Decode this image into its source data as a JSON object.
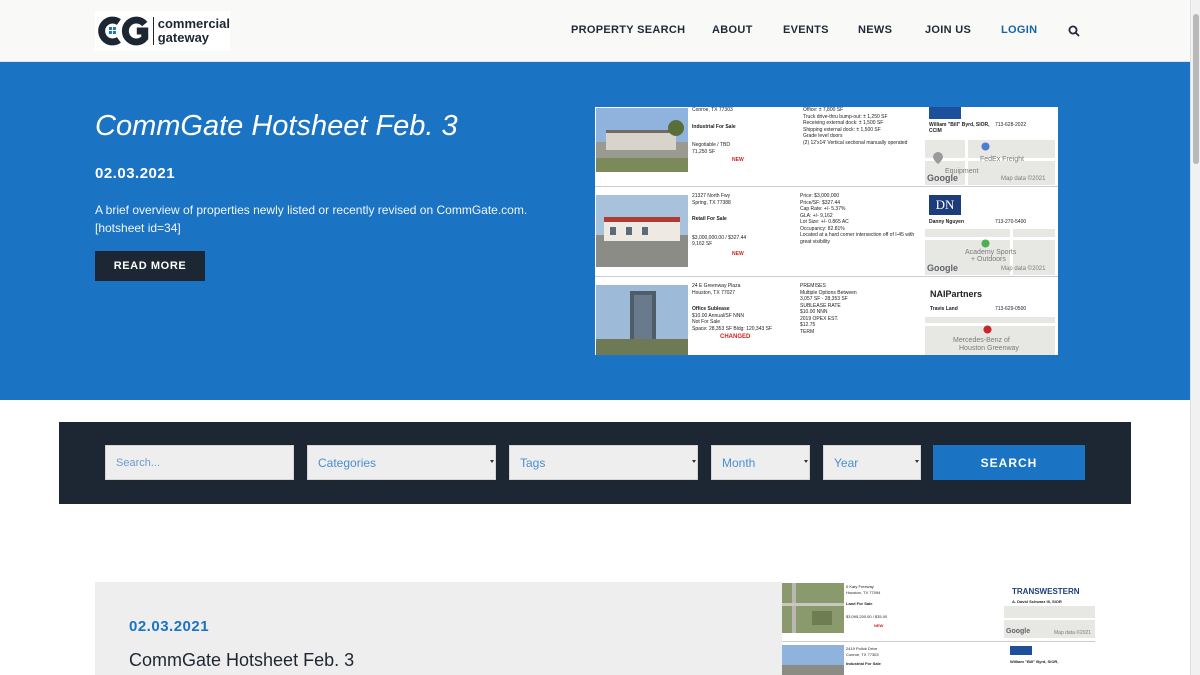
{
  "header": {
    "logo_mark": "CG",
    "logo_line1": "commercial",
    "logo_line2": "gateway",
    "nav": [
      {
        "label": "PROPERTY SEARCH"
      },
      {
        "label": "ABOUT"
      },
      {
        "label": "EVENTS"
      },
      {
        "label": "NEWS"
      },
      {
        "label": "JOIN US"
      },
      {
        "label": "LOGIN"
      }
    ],
    "search_icon": "search-icon"
  },
  "hero": {
    "title": "CommGate Hotsheet Feb. 3",
    "date": "02.03.2021",
    "description": "A brief overview of properties newly listed or recently revised on CommGate.com. [hotsheet id=34]",
    "read_more": "READ MORE",
    "hotsheet": {
      "rows": [
        {
          "location": "Conroe, TX 77303",
          "type": "Industrial For Sale",
          "price": "Negotiable / TBD",
          "size": "71,250 SF",
          "tag": "NEW",
          "details": [
            "Office: ± 7,800 SF",
            "Truck drive-thru bump-out: ± 1,250 SF",
            "Receiving external dock: ± 1,500 SF",
            "Shipping external dock: ± 1,500 SF",
            "Grade level doors",
            "(2) 12'x14' Vertical sectional manually operated"
          ],
          "agent": "William \"Bill\" Byrd, SIOR,",
          "agent2": "CCIM",
          "phone": "713-628-2022",
          "map_labels": [
            "FedEx Freight",
            "Equipment"
          ],
          "map_data": "Map data ©2021"
        },
        {
          "location": "21327 North Fwy",
          "location2": "Spring, TX 77388",
          "type": "Retail For Sale",
          "price": "$3,000,000.00 / $327.44",
          "size": "9,162 SF",
          "tag": "NEW",
          "details": [
            "Price: $3,000,000",
            "Price/SF: $327.44",
            "Cap Rate: +/- 5.37%",
            "GLA: +/- 9,162",
            "Lot Size: +/- 0.865 AC",
            "Occupancy: 82.81%",
            "Located at a hard corner intersection off of I-45 with great visibility"
          ],
          "brand": "DN",
          "agent": "Danny Nguyen",
          "phone": "713-270-5400",
          "map_labels": [
            "Academy Sports",
            "+ Outdoors"
          ],
          "map_data": "Map data ©2021"
        },
        {
          "location": "24 E Greenway Plaza",
          "location2": "Houston, TX 77027",
          "type": "Office Sublease",
          "price": "$10.00 Annual/SF NNN",
          "price2": "Not For Sale",
          "size": "Space: 28,353 SF Bldg: 120,343 SF",
          "tag": "CHANGED",
          "details": [
            "PREMISES",
            "Multiple Options Between",
            "3,057 SF - 28,353 SF",
            "SUBLEASE RATE",
            "$10.00 NNN",
            "2019 OPEX EST.",
            "$12.75",
            "TERM"
          ],
          "brand": "NAIPartners",
          "agent": "Travis Land",
          "phone": "713-629-0500",
          "map_labels": [
            "Mercedes-Benz of",
            "Houston Greenway"
          ]
        }
      ],
      "google": "Google"
    }
  },
  "search": {
    "placeholder": "Search...",
    "categories": "Categories",
    "tags": "Tags",
    "month": "Month",
    "year": "Year",
    "button": "SEARCH"
  },
  "post": {
    "date": "02.03.2021",
    "title": "CommGate Hotsheet Feb. 3",
    "thumb": {
      "row1_address": "0 Katy Freeway",
      "row1_city": "Houston, TX 77094",
      "row1_type": "Land For Sale",
      "row1_price": "$3,095,200.00 / $35.00",
      "row1_tag": "NEW",
      "row1_brand": "TRANSWESTERN",
      "row1_agent": "A. David Schwarz III, SIOR",
      "row2_address": "2419 Pollok Drive",
      "row2_city": "Conroe, TX 77303",
      "row2_type": "Industrial For Sale",
      "row2_agent": "William \"Bill\" Byrd, SIOR,",
      "map_data": "Map data ©2021",
      "google": "Google"
    }
  },
  "colors": {
    "brand_blue": "#1b73c3",
    "dark_navy": "#1d2733",
    "header_bg": "#f9f9f7",
    "tag_red": "#d02020"
  }
}
